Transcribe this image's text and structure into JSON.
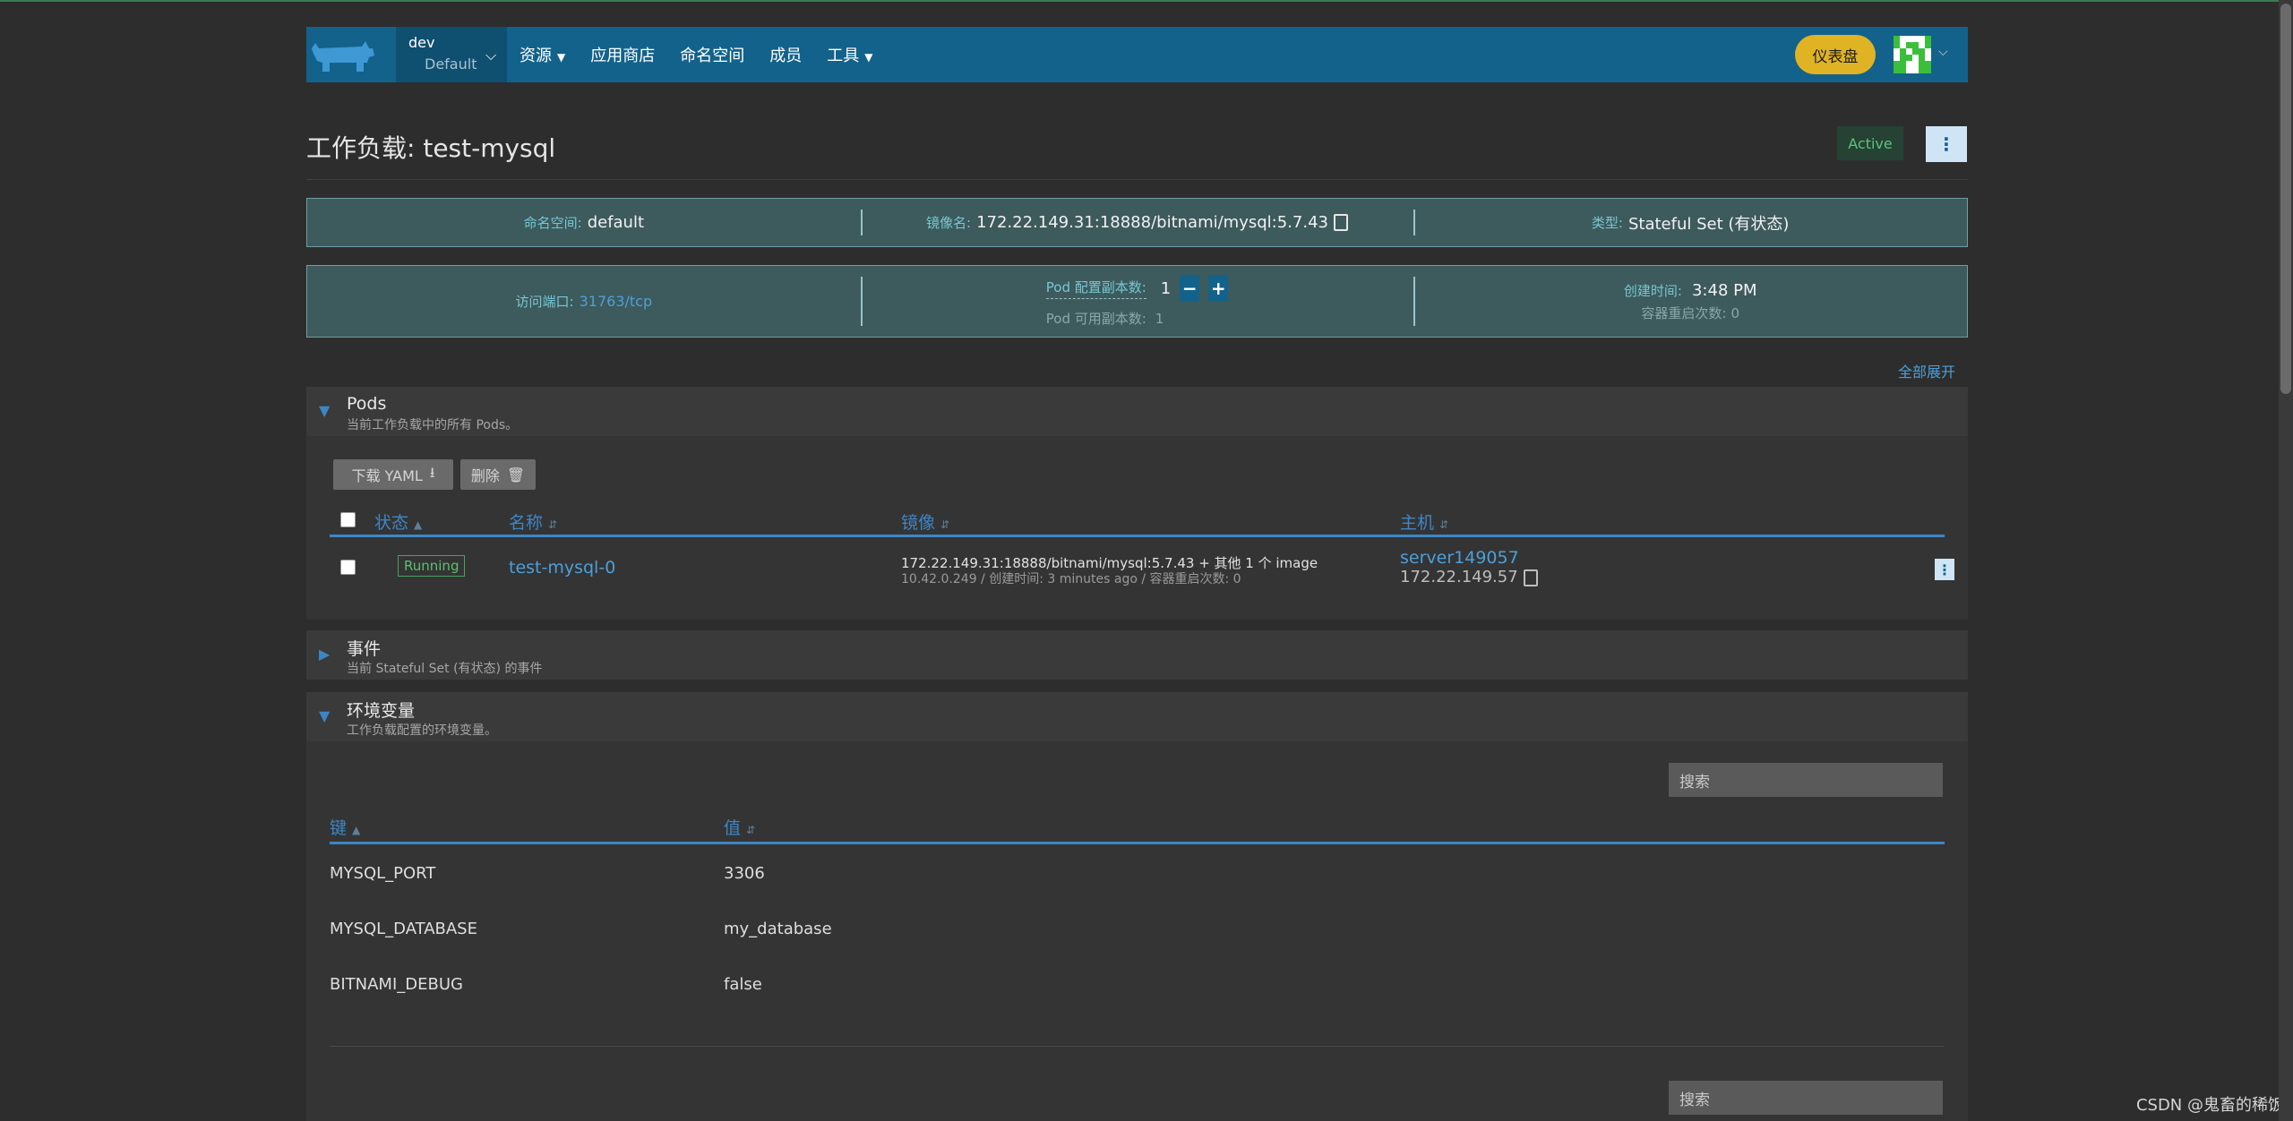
{
  "header": {
    "cluster_name": "dev",
    "project_name": "Default",
    "nav": [
      {
        "label": "资源",
        "has_dropdown": true
      },
      {
        "label": "应用商店",
        "has_dropdown": false
      },
      {
        "label": "命名空间",
        "has_dropdown": false
      },
      {
        "label": "成员",
        "has_dropdown": false
      },
      {
        "label": "工具",
        "has_dropdown": true
      }
    ],
    "dashboard_button": "仪表盘",
    "brand_color": "#13628b"
  },
  "page": {
    "title": "工作负载: test-mysql",
    "status": "Active",
    "expand_all": "全部展开"
  },
  "info": {
    "namespace_label": "命名空间:",
    "namespace_value": "default",
    "image_label": "镜像名:",
    "image_value": "172.22.149.31:18888/bitnami/mysql:5.7.43",
    "type_label": "类型:",
    "type_value": "Stateful Set (有状态)",
    "port_label": "访问端口:",
    "port_value": "31763/tcp",
    "pod_config_label": "Pod 配置副本数:",
    "pod_config_value": "1",
    "pod_available_label": "Pod 可用副本数:",
    "pod_available_value": "1",
    "created_label": "创建时间:",
    "created_value": "3:48 PM",
    "restarts_label": "容器重启次数:",
    "restarts_value": "0"
  },
  "pods": {
    "title": "Pods",
    "subtitle": "当前工作负载中的所有 Pods。",
    "download_yaml": "下载 YAML",
    "delete": "删除",
    "columns": [
      "状态",
      "名称",
      "镜像",
      "主机"
    ],
    "rows": [
      {
        "status": "Running",
        "name": "test-mysql-0",
        "image": "172.22.149.31:18888/bitnami/mysql:5.7.43 + 其他 1 个 image",
        "ip_detail": "10.42.0.249 / 创建时间: 3 minutes ago / 容器重启次数: 0",
        "host": "server149057",
        "host_ip": "172.22.149.57"
      }
    ]
  },
  "events": {
    "title": "事件",
    "subtitle": "当前 Stateful Set (有状态) 的事件"
  },
  "env": {
    "title": "环境变量",
    "subtitle": "工作负载配置的环境变量。",
    "search_placeholder": "搜索",
    "columns": [
      "键",
      "值"
    ],
    "rows": [
      {
        "key": "MYSQL_PORT",
        "value": "3306"
      },
      {
        "key": "MYSQL_DATABASE",
        "value": "my_database"
      },
      {
        "key": "BITNAMI_DEBUG",
        "value": "false"
      }
    ],
    "search2_placeholder": "搜索"
  },
  "watermark": "CSDN @鬼畜的稀饭"
}
